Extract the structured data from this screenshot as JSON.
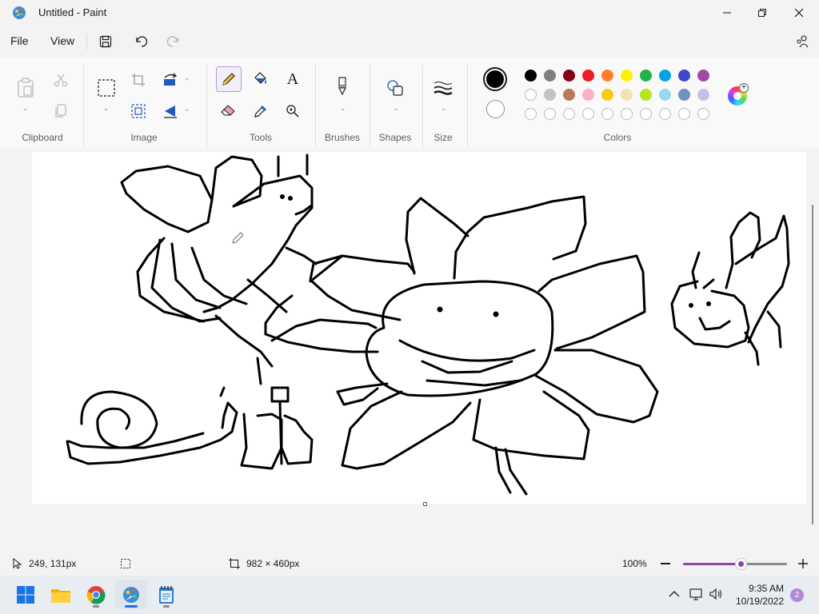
{
  "window": {
    "title": "Untitled - Paint"
  },
  "menu": {
    "file": "File",
    "view": "View"
  },
  "ribbon": {
    "groups": {
      "clipboard": "Clipboard",
      "image": "Image",
      "tools": "Tools",
      "brushes": "Brushes",
      "shapes": "Shapes",
      "size": "Size",
      "colors": "Colors"
    },
    "text_tool_glyph": "A",
    "primary_color": "#000000",
    "secondary_color": "#ffffff",
    "palette_row1": [
      "#000000",
      "#7f7f7f",
      "#880015",
      "#ed1c24",
      "#ff7f27",
      "#fff200",
      "#22b14c",
      "#00a2e8",
      "#3f48cc",
      "#a349a4"
    ],
    "palette_row2": [
      "#ffffff",
      "#c3c3c3",
      "#b97a57",
      "#ffaec9",
      "#ffc90e",
      "#efe4b0",
      "#b5e61d",
      "#99d9ea",
      "#7092be",
      "#c8bfe7"
    ]
  },
  "status": {
    "cursor_position": "249, 131px",
    "canvas_size": "982 × 460px",
    "zoom": "100%",
    "zoom_level": 0.55
  },
  "taskbar": {
    "time": "9:35 AM",
    "date": "10/19/2022",
    "notification_count": "2"
  }
}
